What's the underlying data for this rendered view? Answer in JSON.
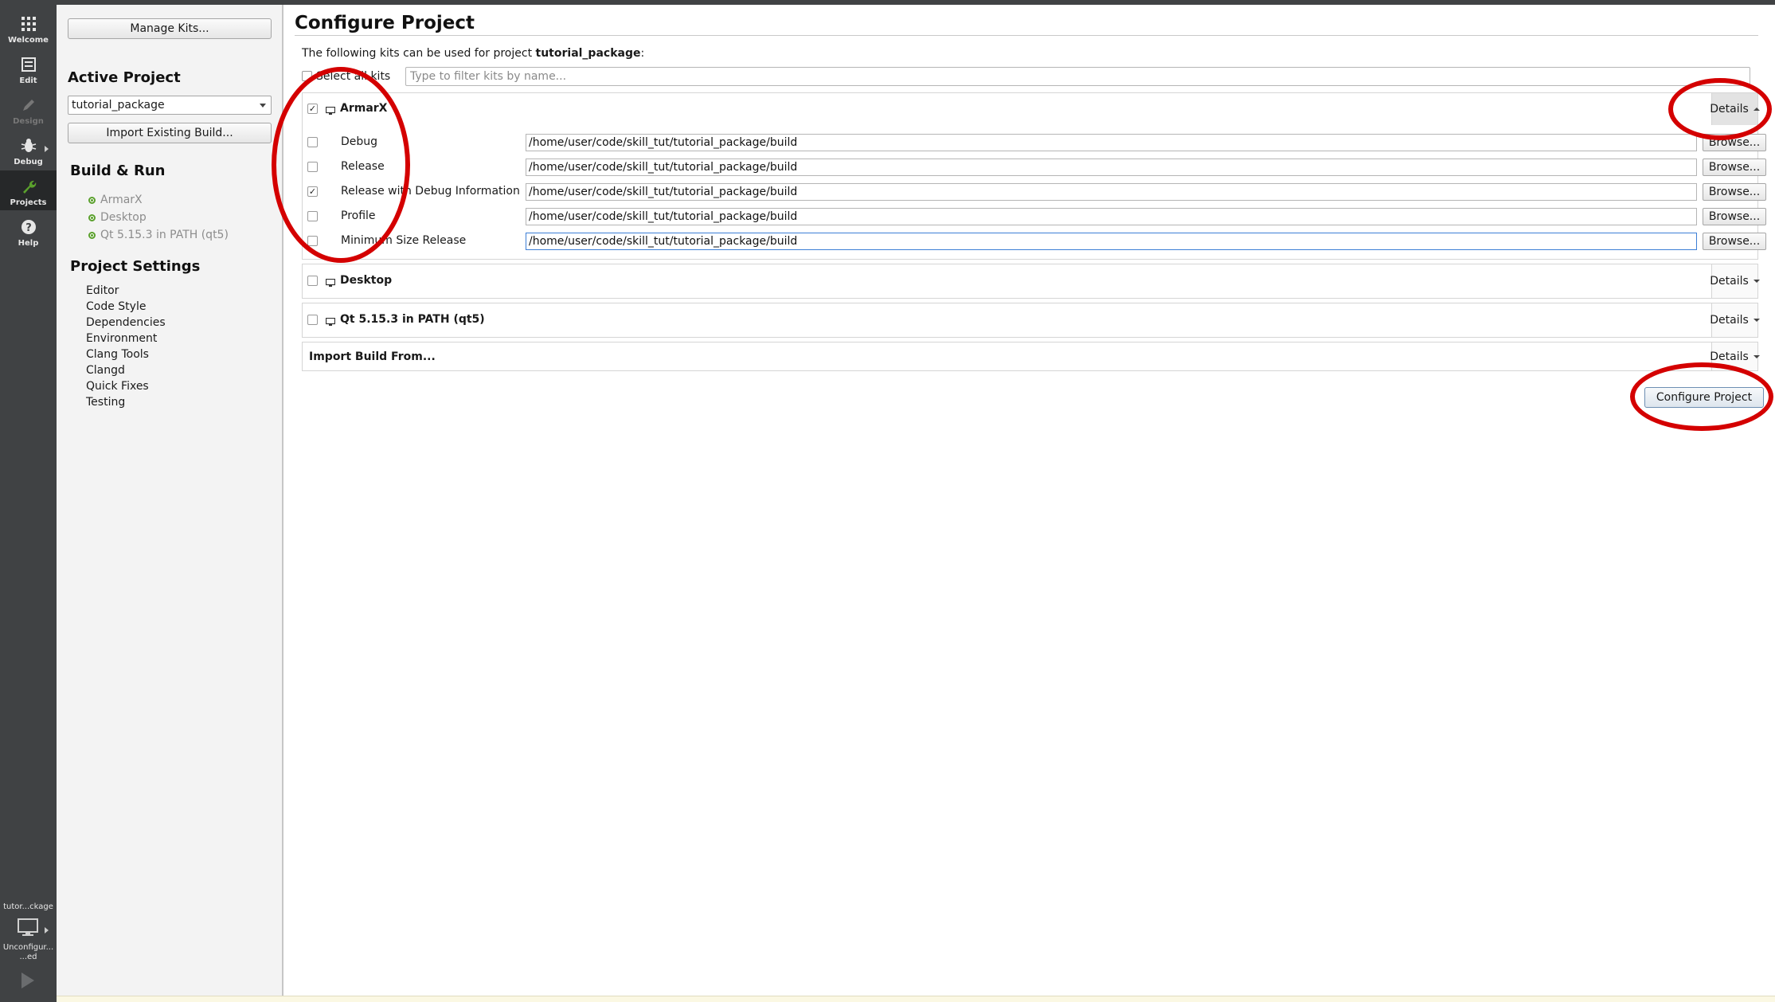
{
  "modebar": {
    "items": [
      {
        "label": "Welcome",
        "icon": "grid-icon"
      },
      {
        "label": "Edit",
        "icon": "edit-icon"
      },
      {
        "label": "Design",
        "icon": "pencil-icon"
      },
      {
        "label": "Debug",
        "icon": "bug-icon"
      },
      {
        "label": "Projects",
        "icon": "wrench-icon"
      },
      {
        "label": "Help",
        "icon": "question-icon"
      }
    ],
    "target_project": "tutor...ckage",
    "target_state_line1": "Unconfigur...",
    "target_state_line2": "...ed"
  },
  "sidepanel": {
    "manage_kits": "Manage Kits...",
    "active_project_heading": "Active Project",
    "active_project_value": "tutorial_package",
    "import_existing": "Import Existing Build...",
    "build_run_heading": "Build & Run",
    "kits": [
      "ArmarX",
      "Desktop",
      "Qt 5.15.3 in PATH (qt5)"
    ],
    "project_settings_heading": "Project Settings",
    "settings": [
      "Editor",
      "Code Style",
      "Dependencies",
      "Environment",
      "Clang Tools",
      "Clangd",
      "Quick Fixes",
      "Testing"
    ]
  },
  "main": {
    "title": "Configure Project",
    "intro_prefix": "The following kits can be used for project ",
    "intro_project": "tutorial_package",
    "intro_suffix": ":",
    "select_all": "Select all kits",
    "filter_placeholder": "Type to filter kits by name...",
    "details_label": "Details",
    "browse_label": "Browse...",
    "kits": [
      {
        "name": "ArmarX",
        "checked": true
      },
      {
        "name": "Desktop",
        "checked": false
      },
      {
        "name": "Qt 5.15.3 in PATH (qt5)",
        "checked": false
      }
    ],
    "build_configs": [
      {
        "label": "Debug",
        "checked": false,
        "path": "/home/user/code/skill_tut/tutorial_package/build"
      },
      {
        "label": "Release",
        "checked": false,
        "path": "/home/user/code/skill_tut/tutorial_package/build"
      },
      {
        "label": "Release with Debug Information",
        "checked": true,
        "path": "/home/user/code/skill_tut/tutorial_package/build"
      },
      {
        "label": "Profile",
        "checked": false,
        "path": "/home/user/code/skill_tut/tutorial_package/build"
      },
      {
        "label": "Minimum Size Release",
        "checked": false,
        "path": "/home/user/code/skill_tut/tutorial_package/build"
      }
    ],
    "import_build_from": "Import Build From...",
    "configure_button": "Configure Project"
  },
  "colors": {
    "annotation": "#d40000",
    "modebar": "#404244",
    "status_ok": "#5aa02c"
  }
}
